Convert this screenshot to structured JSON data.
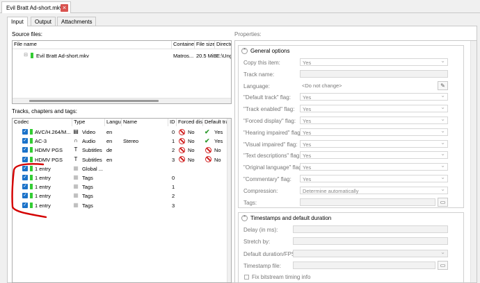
{
  "window": {
    "doc_tab": "Evil Bratt Ad-short.mkv"
  },
  "subtabs": [
    "Input",
    "Output",
    "Attachments"
  ],
  "source": {
    "label": "Source files:",
    "columns": [
      "File name",
      "Containe",
      "File size",
      "Directo"
    ],
    "row": {
      "name": "Evil Bratt Ad-short.mkv",
      "container": "Matros...",
      "size": "20.5 MiB",
      "dir": "E:\\Ung"
    }
  },
  "tracks": {
    "label": "Tracks, chapters and tags:",
    "columns": [
      "Codec",
      "Type",
      "Langu",
      "Name",
      "ID",
      "Forced dis",
      "Default tra"
    ],
    "rows": [
      {
        "codec": "AVC/H.264/M...",
        "type": "Video",
        "lang": "en",
        "name": "",
        "id": "0",
        "forced": "No",
        "default": "Yes",
        "icon": "film-icon"
      },
      {
        "codec": "AC-3",
        "type": "Audio",
        "lang": "en",
        "name": "Stereo",
        "id": "1",
        "forced": "No",
        "default": "Yes",
        "icon": "headphones-icon"
      },
      {
        "codec": "HDMV PGS",
        "type": "Subtitles",
        "lang": "de",
        "name": "",
        "id": "2",
        "forced": "No",
        "default": "No",
        "icon": "text-icon"
      },
      {
        "codec": "HDMV PGS",
        "type": "Subtitles",
        "lang": "en",
        "name": "",
        "id": "3",
        "forced": "No",
        "default": "No",
        "icon": "text-icon"
      },
      {
        "codec": "1 entry",
        "type": "Global ...",
        "lang": "",
        "name": "",
        "id": "",
        "forced": "",
        "default": "",
        "icon": "tag-icon"
      },
      {
        "codec": "1 entry",
        "type": "Tags",
        "lang": "",
        "name": "",
        "id": "0",
        "forced": "",
        "default": "",
        "icon": "tag-icon"
      },
      {
        "codec": "1 entry",
        "type": "Tags",
        "lang": "",
        "name": "",
        "id": "1",
        "forced": "",
        "default": "",
        "icon": "tag-icon"
      },
      {
        "codec": "1 entry",
        "type": "Tags",
        "lang": "",
        "name": "",
        "id": "2",
        "forced": "",
        "default": "",
        "icon": "tag-icon"
      },
      {
        "codec": "1 entry",
        "type": "Tags",
        "lang": "",
        "name": "",
        "id": "3",
        "forced": "",
        "default": "",
        "icon": "tag-icon"
      }
    ]
  },
  "properties": {
    "label": "Properties:",
    "general": {
      "title": "General options",
      "rows": [
        {
          "label": "Copy this item:",
          "value": "Yes"
        },
        {
          "label": "Track name:",
          "value": ""
        },
        {
          "label": "Language:",
          "value": "<Do not change>"
        },
        {
          "label": "\"Default track\" flag:",
          "value": "Yes"
        },
        {
          "label": "\"Track enabled\" flag:",
          "value": "Yes"
        },
        {
          "label": "\"Forced display\" flag:",
          "value": "Yes"
        },
        {
          "label": "\"Hearing impaired\" flag:",
          "value": "Yes"
        },
        {
          "label": "\"Visual impaired\" flag:",
          "value": "Yes"
        },
        {
          "label": "\"Text descriptions\" flag:",
          "value": "Yes"
        },
        {
          "label": "\"Original language\" flag:",
          "value": "Yes"
        },
        {
          "label": "\"Commentary\" flag:",
          "value": "Yes"
        },
        {
          "label": "Compression:",
          "value": "Determine automatically"
        },
        {
          "label": "Tags:",
          "value": ""
        }
      ]
    },
    "timestamps": {
      "title": "Timestamps and default duration",
      "rows": [
        {
          "label": "Delay (in ms):"
        },
        {
          "label": "Stretch by:"
        },
        {
          "label": "Default duration/FPS:"
        },
        {
          "label": "Timestamp file:"
        }
      ],
      "checkbox": "Fix bitstream timing info"
    }
  },
  "annotation_color": "#d40000"
}
